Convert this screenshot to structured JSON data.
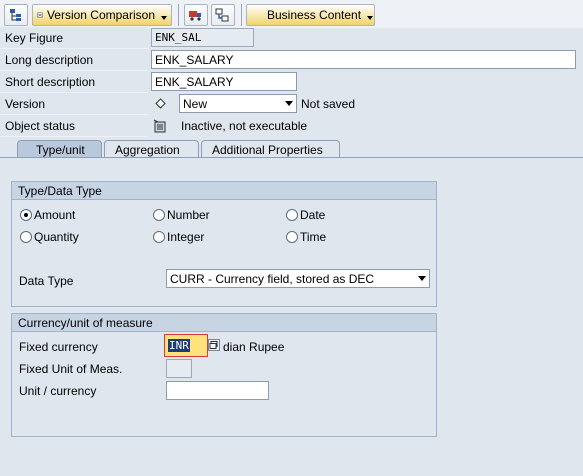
{
  "toolbar": {
    "version_comparison": "Version Comparison",
    "business_content": "Business Content"
  },
  "header": {
    "key_figure": {
      "label": "Key Figure",
      "value": "ENK_SAL"
    },
    "long_description": {
      "label": "Long description",
      "value": "ENK_SALARY"
    },
    "short_description": {
      "label": "Short description",
      "value": "ENK_SALARY"
    },
    "version": {
      "label": "Version",
      "value": "New",
      "status": "Not saved"
    },
    "object_status": {
      "label": "Object status",
      "value": "Inactive, not executable"
    }
  },
  "tabs": [
    "Type/unit",
    "Aggregation",
    "Additional Properties"
  ],
  "type_group": {
    "title": "Type/Data Type",
    "radios": {
      "amount": "Amount",
      "number": "Number",
      "date": "Date",
      "quantity": "Quantity",
      "integer": "Integer",
      "time": "Time"
    },
    "data_type_label": "Data Type",
    "data_type_value": "CURR - Currency field, stored as DEC"
  },
  "currency_group": {
    "title": "Currency/unit of measure",
    "fixed_currency_label": "Fixed currency",
    "fixed_currency_value": "INR",
    "fixed_currency_text": "dian Rupee",
    "fixed_unit_label": "Fixed Unit of Meas.",
    "unit_currency_label": "Unit / currency"
  },
  "colors": {
    "highlight": "#ffe27a",
    "select": "#1c3d74",
    "error_border": "#d93b3b"
  }
}
